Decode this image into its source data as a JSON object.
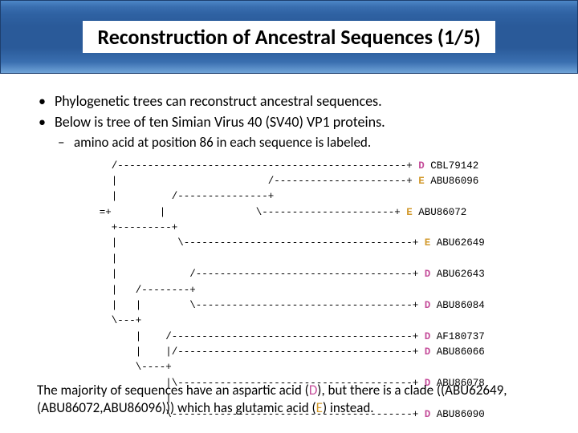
{
  "title": "Reconstruction of Ancestral Sequences (1/5)",
  "bullets": {
    "b1": "Phylogenetic trees can reconstruct ancestral sequences.",
    "b2": "Below is tree of ten Simian Virus 40 (SV40) VP1 proteins.",
    "sub1": "amino acid at position 86 in each sequence is labeled."
  },
  "tree": {
    "rows": [
      {
        "prefix": "   /------------------------------------------------+ ",
        "aa": "D",
        "acc": " CBL79142"
      },
      {
        "prefix": "   |                         /----------------------+ ",
        "aa": "E",
        "acc": " ABU86096"
      },
      {
        "prefix": "   |         /---------------+                        ",
        "aa": "",
        "acc": ""
      },
      {
        "prefix": " =+        |               \\----------------------+ ",
        "aa": "E",
        "acc": " ABU86072"
      },
      {
        "prefix": "   +---------+                                        ",
        "aa": "",
        "acc": ""
      },
      {
        "prefix": "   |          \\--------------------------------------+ ",
        "aa": "E",
        "acc": " ABU62649"
      },
      {
        "prefix": "   |                                                   ",
        "aa": "",
        "acc": ""
      },
      {
        "prefix": "   |            /------------------------------------+ ",
        "aa": "D",
        "acc": " ABU62643"
      },
      {
        "prefix": "   |   /--------+                                      ",
        "aa": "",
        "acc": ""
      },
      {
        "prefix": "   |   |        \\------------------------------------+ ",
        "aa": "D",
        "acc": " ABU86084"
      },
      {
        "prefix": "   \\---+                                              ",
        "aa": "",
        "acc": ""
      },
      {
        "prefix": "       |    /----------------------------------------+ ",
        "aa": "D",
        "acc": " AF180737"
      },
      {
        "prefix": "       |    |/---------------------------------------+ ",
        "aa": "D",
        "acc": " ABU86066"
      },
      {
        "prefix": "       \\----+                                         ",
        "aa": "",
        "acc": ""
      },
      {
        "prefix": "            |\\---------------------------------------+ ",
        "aa": "D",
        "acc": " ABU86078"
      },
      {
        "prefix": "            |                                          ",
        "aa": "",
        "acc": ""
      },
      {
        "prefix": "            \\----------------------------------------+ ",
        "aa": "D",
        "acc": " ABU86090"
      }
    ]
  },
  "footer": {
    "t1": "The majority of sequences have an aspartic acid (",
    "d": "D",
    "t2": "), but there is a clade ((ABU62649,(ABU86072,ABU86096))) which has glutamic acid (",
    "e": "E",
    "t3": ") instead."
  }
}
